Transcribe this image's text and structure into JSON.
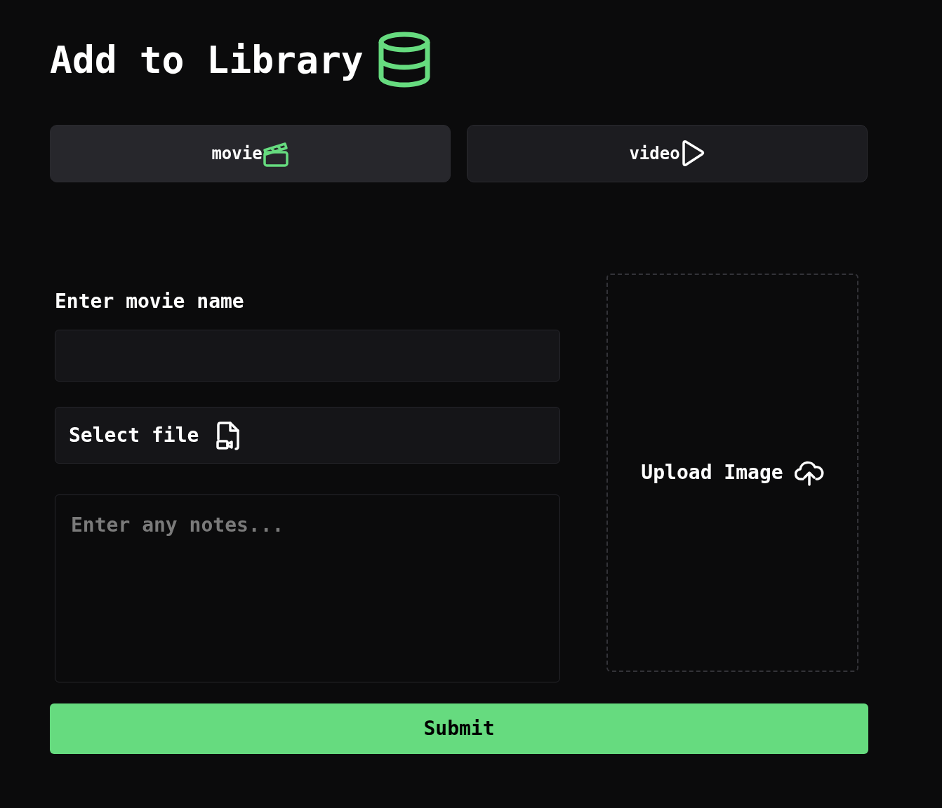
{
  "title": "Add to Library",
  "tabs": [
    {
      "label": "movie",
      "kind": "movie",
      "selected": true
    },
    {
      "label": "video",
      "kind": "video",
      "selected": false
    }
  ],
  "form": {
    "name_label": "Enter movie name",
    "file_button": "Select file",
    "notes": {
      "placeholder": "Enter any notes..."
    },
    "upload": "Upload Image"
  },
  "submit": "Submit"
}
